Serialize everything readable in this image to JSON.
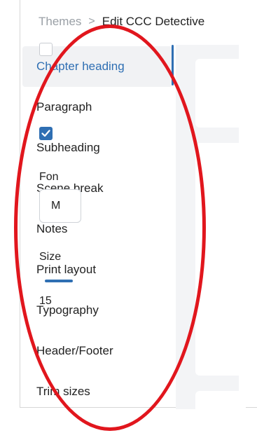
{
  "breadcrumb": {
    "root": "Themes",
    "separator": ">",
    "current": "Edit CCC Detective"
  },
  "sidebar": {
    "items": [
      {
        "label": "Chapter heading",
        "active": true
      },
      {
        "label": "Paragraph"
      },
      {
        "label": "Subheading"
      },
      {
        "label": "Scene break"
      },
      {
        "label": "Notes"
      },
      {
        "label": "Print layout"
      },
      {
        "label": "Typography"
      },
      {
        "label": "Header/Footer"
      },
      {
        "label": "Trim sizes"
      }
    ]
  },
  "content": {
    "font_label": "Fon",
    "font_value": "M",
    "size_label": "Size",
    "size_value": "15"
  },
  "colors": {
    "accent": "#2f6fb3",
    "annotation": "#e1161d"
  }
}
